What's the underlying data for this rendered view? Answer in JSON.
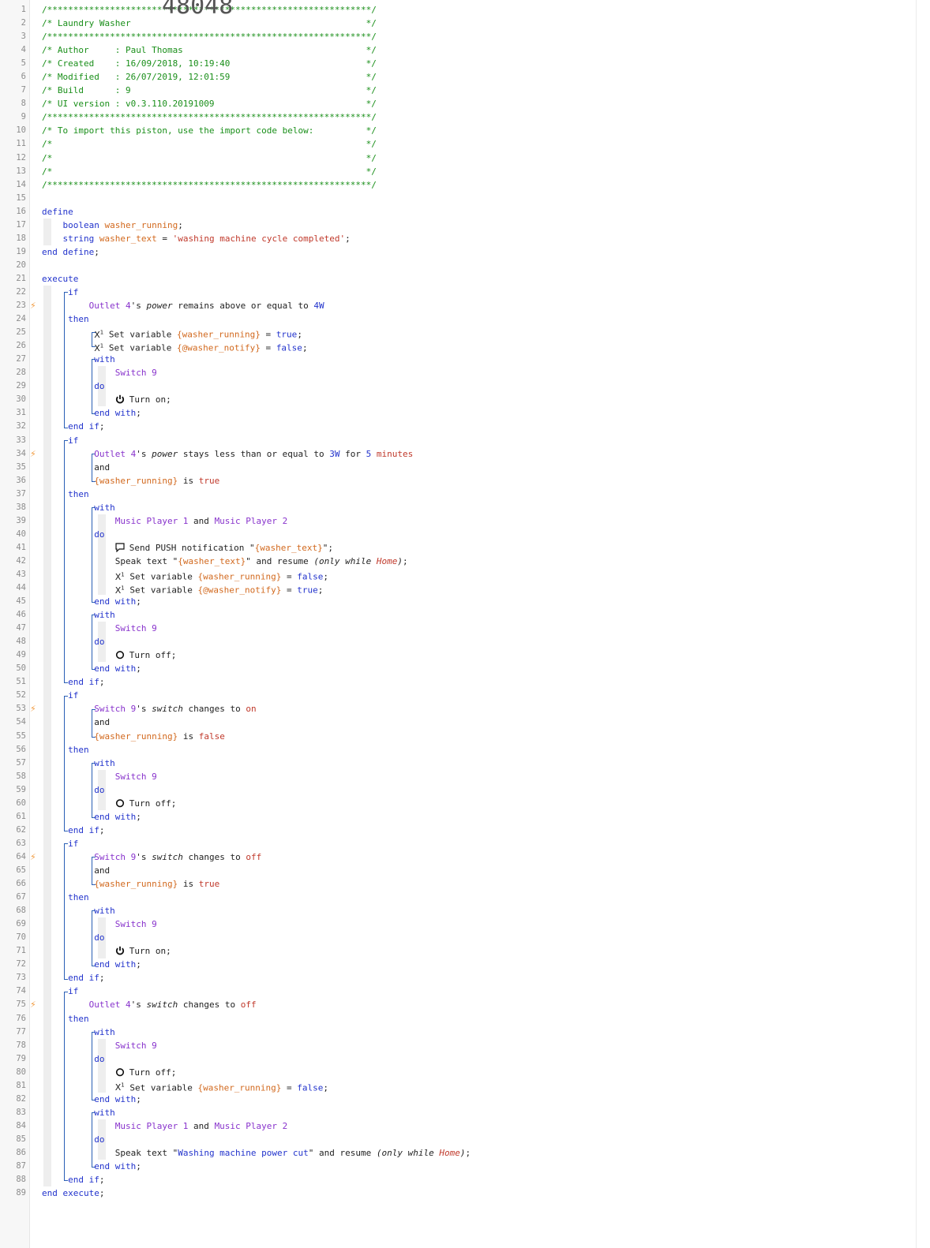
{
  "piston": {
    "name": "Laundry Washer",
    "author": "Paul Thomas",
    "created": "16/09/2018, 10:19:40",
    "modified": "26/07/2019, 12:01:59",
    "build": "9",
    "ui_version": "v0.3.110.20191009",
    "import_code": "48048"
  },
  "lines": [
    [
      {
        "c": "cmt",
        "t": "/**************************************************************/"
      }
    ],
    [
      {
        "c": "cmt",
        "t": "/* Laundry Washer                                             */"
      }
    ],
    [
      {
        "c": "cmt",
        "t": "/**************************************************************/"
      }
    ],
    [
      {
        "c": "cmt",
        "t": "/* Author     : Paul Thomas                                   */"
      }
    ],
    [
      {
        "c": "cmt",
        "t": "/* Created    : 16/09/2018, 10:19:40                          */"
      }
    ],
    [
      {
        "c": "cmt",
        "t": "/* Modified   : 26/07/2019, 12:01:59                          */"
      }
    ],
    [
      {
        "c": "cmt",
        "t": "/* Build      : 9                                             */"
      }
    ],
    [
      {
        "c": "cmt",
        "t": "/* UI version : v0.3.110.20191009                             */"
      }
    ],
    [
      {
        "c": "cmt",
        "t": "/**************************************************************/"
      }
    ],
    [
      {
        "c": "cmt",
        "t": "/* To import this piston, use the import code below:          */"
      }
    ],
    [
      {
        "c": "cmt",
        "t": "/*                                                            */"
      }
    ],
    [
      {
        "c": "cmt",
        "t": "/*                                                            */"
      }
    ],
    [
      {
        "c": "cmt",
        "t": "/*                                                            */"
      }
    ],
    [
      {
        "c": "cmt",
        "t": "/**************************************************************/"
      }
    ],
    [],
    [
      {
        "c": "kw",
        "t": "define"
      }
    ],
    [
      {
        "c": "sp",
        "t": "    "
      },
      {
        "c": "kw",
        "t": "boolean"
      },
      {
        "c": "plain",
        "t": " "
      },
      {
        "c": "var",
        "t": "washer_running"
      },
      {
        "c": "plain",
        "t": ";"
      }
    ],
    [
      {
        "c": "sp",
        "t": "    "
      },
      {
        "c": "kw",
        "t": "string"
      },
      {
        "c": "plain",
        "t": " "
      },
      {
        "c": "var",
        "t": "washer_text"
      },
      {
        "c": "plain",
        "t": " = "
      },
      {
        "c": "str",
        "t": "'washing machine cycle completed'"
      },
      {
        "c": "plain",
        "t": ";"
      }
    ],
    [
      {
        "c": "kw",
        "t": "end define"
      },
      {
        "c": "plain",
        "t": ";"
      }
    ],
    [],
    [
      {
        "c": "kw",
        "t": "execute"
      }
    ],
    [
      {
        "c": "sp",
        "t": "     "
      },
      {
        "c": "kw",
        "t": "if"
      }
    ],
    [
      {
        "c": "sp",
        "t": "         "
      },
      {
        "c": "dev",
        "t": "Outlet 4"
      },
      {
        "c": "plain",
        "t": "'s "
      },
      {
        "c": "em",
        "t": "power"
      },
      {
        "c": "plain",
        "t": " remains above or equal to "
      },
      {
        "c": "num",
        "t": "4W"
      }
    ],
    [
      {
        "c": "sp",
        "t": "     "
      },
      {
        "c": "kw",
        "t": "then"
      }
    ],
    [
      {
        "c": "sp",
        "t": "          "
      },
      {
        "c": "x",
        "t": "X"
      },
      {
        "c": "plain",
        "t": " Set variable "
      },
      {
        "c": "var",
        "t": "{washer_running}"
      },
      {
        "c": "plain",
        "t": " = "
      },
      {
        "c": "kw",
        "t": "true"
      },
      {
        "c": "plain",
        "t": ";"
      }
    ],
    [
      {
        "c": "sp",
        "t": "          "
      },
      {
        "c": "x",
        "t": "X"
      },
      {
        "c": "plain",
        "t": " Set variable "
      },
      {
        "c": "var",
        "t": "{@washer_notify}"
      },
      {
        "c": "plain",
        "t": " = "
      },
      {
        "c": "kw",
        "t": "false"
      },
      {
        "c": "plain",
        "t": ";"
      }
    ],
    [
      {
        "c": "sp",
        "t": "          "
      },
      {
        "c": "kw",
        "t": "with"
      }
    ],
    [
      {
        "c": "sp",
        "t": "              "
      },
      {
        "c": "dev",
        "t": "Switch 9"
      }
    ],
    [
      {
        "c": "sp",
        "t": "          "
      },
      {
        "c": "kw",
        "t": "do"
      }
    ],
    [
      {
        "c": "sp",
        "t": "              "
      },
      {
        "c": "pwr",
        "t": "on"
      },
      {
        "c": "plain",
        "t": "Turn on;"
      }
    ],
    [
      {
        "c": "sp",
        "t": "          "
      },
      {
        "c": "kw",
        "t": "end with"
      },
      {
        "c": "plain",
        "t": ";"
      }
    ],
    [
      {
        "c": "sp",
        "t": "     "
      },
      {
        "c": "kw",
        "t": "end if"
      },
      {
        "c": "plain",
        "t": ";"
      }
    ],
    [
      {
        "c": "sp",
        "t": "     "
      },
      {
        "c": "kw",
        "t": "if"
      }
    ],
    [
      {
        "c": "sp",
        "t": "          "
      },
      {
        "c": "dev",
        "t": "Outlet 4"
      },
      {
        "c": "plain",
        "t": "'s "
      },
      {
        "c": "em",
        "t": "power"
      },
      {
        "c": "plain",
        "t": " stays less than or equal to "
      },
      {
        "c": "num",
        "t": "3W"
      },
      {
        "c": "plain",
        "t": " for "
      },
      {
        "c": "num",
        "t": "5 "
      },
      {
        "c": "str",
        "t": "minutes"
      }
    ],
    [
      {
        "c": "sp",
        "t": "          "
      },
      {
        "c": "plain",
        "t": "and"
      }
    ],
    [
      {
        "c": "sp",
        "t": "          "
      },
      {
        "c": "var",
        "t": "{washer_running}"
      },
      {
        "c": "plain",
        "t": " is "
      },
      {
        "c": "str",
        "t": "true"
      }
    ],
    [
      {
        "c": "sp",
        "t": "     "
      },
      {
        "c": "kw",
        "t": "then"
      }
    ],
    [
      {
        "c": "sp",
        "t": "          "
      },
      {
        "c": "kw",
        "t": "with"
      }
    ],
    [
      {
        "c": "sp",
        "t": "              "
      },
      {
        "c": "dev",
        "t": "Music Player 1"
      },
      {
        "c": "plain",
        "t": " and "
      },
      {
        "c": "dev",
        "t": "Music Player 2"
      }
    ],
    [
      {
        "c": "sp",
        "t": "          "
      },
      {
        "c": "kw",
        "t": "do"
      }
    ],
    [
      {
        "c": "sp",
        "t": "              "
      },
      {
        "c": "chat",
        "t": "push"
      },
      {
        "c": "plain",
        "t": "Send PUSH notification \""
      },
      {
        "c": "var",
        "t": "{washer_text}"
      },
      {
        "c": "plain",
        "t": "\";"
      }
    ],
    [
      {
        "c": "sp",
        "t": "              "
      },
      {
        "c": "plain",
        "t": "Speak text \""
      },
      {
        "c": "var",
        "t": "{washer_text}"
      },
      {
        "c": "plain",
        "t": "\" and resume "
      },
      {
        "c": "em",
        "t": "(only while "
      },
      {
        "c": "emstr",
        "t": "Home"
      },
      {
        "c": "em",
        "t": ")"
      },
      {
        "c": "plain",
        "t": ";"
      }
    ],
    [
      {
        "c": "sp",
        "t": "              "
      },
      {
        "c": "x",
        "t": "X"
      },
      {
        "c": "plain",
        "t": " Set variable "
      },
      {
        "c": "var",
        "t": "{washer_running}"
      },
      {
        "c": "plain",
        "t": " = "
      },
      {
        "c": "kw",
        "t": "false"
      },
      {
        "c": "plain",
        "t": ";"
      }
    ],
    [
      {
        "c": "sp",
        "t": "              "
      },
      {
        "c": "x",
        "t": "X"
      },
      {
        "c": "plain",
        "t": " Set variable "
      },
      {
        "c": "var",
        "t": "{@washer_notify}"
      },
      {
        "c": "plain",
        "t": " = "
      },
      {
        "c": "kw",
        "t": "true"
      },
      {
        "c": "plain",
        "t": ";"
      }
    ],
    [
      {
        "c": "sp",
        "t": "          "
      },
      {
        "c": "kw",
        "t": "end with"
      },
      {
        "c": "plain",
        "t": ";"
      }
    ],
    [
      {
        "c": "sp",
        "t": "          "
      },
      {
        "c": "kw",
        "t": "with"
      }
    ],
    [
      {
        "c": "sp",
        "t": "              "
      },
      {
        "c": "dev",
        "t": "Switch 9"
      }
    ],
    [
      {
        "c": "sp",
        "t": "          "
      },
      {
        "c": "kw",
        "t": "do"
      }
    ],
    [
      {
        "c": "sp",
        "t": "              "
      },
      {
        "c": "pwr",
        "t": "off"
      },
      {
        "c": "plain",
        "t": "Turn off;"
      }
    ],
    [
      {
        "c": "sp",
        "t": "          "
      },
      {
        "c": "kw",
        "t": "end with"
      },
      {
        "c": "plain",
        "t": ";"
      }
    ],
    [
      {
        "c": "sp",
        "t": "     "
      },
      {
        "c": "kw",
        "t": "end if"
      },
      {
        "c": "plain",
        "t": ";"
      }
    ],
    [
      {
        "c": "sp",
        "t": "     "
      },
      {
        "c": "kw",
        "t": "if"
      }
    ],
    [
      {
        "c": "sp",
        "t": "          "
      },
      {
        "c": "dev",
        "t": "Switch 9"
      },
      {
        "c": "plain",
        "t": "'s "
      },
      {
        "c": "em",
        "t": "switch"
      },
      {
        "c": "plain",
        "t": " changes to "
      },
      {
        "c": "str",
        "t": "on"
      }
    ],
    [
      {
        "c": "sp",
        "t": "          "
      },
      {
        "c": "plain",
        "t": "and"
      }
    ],
    [
      {
        "c": "sp",
        "t": "          "
      },
      {
        "c": "var",
        "t": "{washer_running}"
      },
      {
        "c": "plain",
        "t": " is "
      },
      {
        "c": "str",
        "t": "false"
      }
    ],
    [
      {
        "c": "sp",
        "t": "     "
      },
      {
        "c": "kw",
        "t": "then"
      }
    ],
    [
      {
        "c": "sp",
        "t": "          "
      },
      {
        "c": "kw",
        "t": "with"
      }
    ],
    [
      {
        "c": "sp",
        "t": "              "
      },
      {
        "c": "dev",
        "t": "Switch 9"
      }
    ],
    [
      {
        "c": "sp",
        "t": "          "
      },
      {
        "c": "kw",
        "t": "do"
      }
    ],
    [
      {
        "c": "sp",
        "t": "              "
      },
      {
        "c": "pwr",
        "t": "off"
      },
      {
        "c": "plain",
        "t": "Turn off;"
      }
    ],
    [
      {
        "c": "sp",
        "t": "          "
      },
      {
        "c": "kw",
        "t": "end with"
      },
      {
        "c": "plain",
        "t": ";"
      }
    ],
    [
      {
        "c": "sp",
        "t": "     "
      },
      {
        "c": "kw",
        "t": "end if"
      },
      {
        "c": "plain",
        "t": ";"
      }
    ],
    [
      {
        "c": "sp",
        "t": "     "
      },
      {
        "c": "kw",
        "t": "if"
      }
    ],
    [
      {
        "c": "sp",
        "t": "          "
      },
      {
        "c": "dev",
        "t": "Switch 9"
      },
      {
        "c": "plain",
        "t": "'s "
      },
      {
        "c": "em",
        "t": "switch"
      },
      {
        "c": "plain",
        "t": " changes to "
      },
      {
        "c": "str",
        "t": "off"
      }
    ],
    [
      {
        "c": "sp",
        "t": "          "
      },
      {
        "c": "plain",
        "t": "and"
      }
    ],
    [
      {
        "c": "sp",
        "t": "          "
      },
      {
        "c": "var",
        "t": "{washer_running}"
      },
      {
        "c": "plain",
        "t": " is "
      },
      {
        "c": "str",
        "t": "true"
      }
    ],
    [
      {
        "c": "sp",
        "t": "     "
      },
      {
        "c": "kw",
        "t": "then"
      }
    ],
    [
      {
        "c": "sp",
        "t": "          "
      },
      {
        "c": "kw",
        "t": "with"
      }
    ],
    [
      {
        "c": "sp",
        "t": "              "
      },
      {
        "c": "dev",
        "t": "Switch 9"
      }
    ],
    [
      {
        "c": "sp",
        "t": "          "
      },
      {
        "c": "kw",
        "t": "do"
      }
    ],
    [
      {
        "c": "sp",
        "t": "              "
      },
      {
        "c": "pwr",
        "t": "on"
      },
      {
        "c": "plain",
        "t": "Turn on;"
      }
    ],
    [
      {
        "c": "sp",
        "t": "          "
      },
      {
        "c": "kw",
        "t": "end with"
      },
      {
        "c": "plain",
        "t": ";"
      }
    ],
    [
      {
        "c": "sp",
        "t": "     "
      },
      {
        "c": "kw",
        "t": "end if"
      },
      {
        "c": "plain",
        "t": ";"
      }
    ],
    [
      {
        "c": "sp",
        "t": "     "
      },
      {
        "c": "kw",
        "t": "if"
      }
    ],
    [
      {
        "c": "sp",
        "t": "         "
      },
      {
        "c": "dev",
        "t": "Outlet 4"
      },
      {
        "c": "plain",
        "t": "'s "
      },
      {
        "c": "em",
        "t": "switch"
      },
      {
        "c": "plain",
        "t": " changes to "
      },
      {
        "c": "str",
        "t": "off"
      }
    ],
    [
      {
        "c": "sp",
        "t": "     "
      },
      {
        "c": "kw",
        "t": "then"
      }
    ],
    [
      {
        "c": "sp",
        "t": "          "
      },
      {
        "c": "kw",
        "t": "with"
      }
    ],
    [
      {
        "c": "sp",
        "t": "              "
      },
      {
        "c": "dev",
        "t": "Switch 9"
      }
    ],
    [
      {
        "c": "sp",
        "t": "          "
      },
      {
        "c": "kw",
        "t": "do"
      }
    ],
    [
      {
        "c": "sp",
        "t": "              "
      },
      {
        "c": "pwr",
        "t": "off"
      },
      {
        "c": "plain",
        "t": "Turn off;"
      }
    ],
    [
      {
        "c": "sp",
        "t": "              "
      },
      {
        "c": "x",
        "t": "X"
      },
      {
        "c": "plain",
        "t": " Set variable "
      },
      {
        "c": "var",
        "t": "{washer_running}"
      },
      {
        "c": "plain",
        "t": " = "
      },
      {
        "c": "kw",
        "t": "false"
      },
      {
        "c": "plain",
        "t": ";"
      }
    ],
    [
      {
        "c": "sp",
        "t": "          "
      },
      {
        "c": "kw",
        "t": "end with"
      },
      {
        "c": "plain",
        "t": ";"
      }
    ],
    [
      {
        "c": "sp",
        "t": "          "
      },
      {
        "c": "kw",
        "t": "with"
      }
    ],
    [
      {
        "c": "sp",
        "t": "              "
      },
      {
        "c": "dev",
        "t": "Music Player 1"
      },
      {
        "c": "plain",
        "t": " and "
      },
      {
        "c": "dev",
        "t": "Music Player 2"
      }
    ],
    [
      {
        "c": "sp",
        "t": "          "
      },
      {
        "c": "kw",
        "t": "do"
      }
    ],
    [
      {
        "c": "sp",
        "t": "              "
      },
      {
        "c": "plain",
        "t": "Speak text \""
      },
      {
        "c": "num",
        "t": "Washing machine power cut"
      },
      {
        "c": "plain",
        "t": "\" and resume "
      },
      {
        "c": "em",
        "t": "(only while "
      },
      {
        "c": "emstr",
        "t": "Home"
      },
      {
        "c": "em",
        "t": ")"
      },
      {
        "c": "plain",
        "t": ";"
      }
    ],
    [
      {
        "c": "sp",
        "t": "          "
      },
      {
        "c": "kw",
        "t": "end with"
      },
      {
        "c": "plain",
        "t": ";"
      }
    ],
    [
      {
        "c": "sp",
        "t": "     "
      },
      {
        "c": "kw",
        "t": "end if"
      },
      {
        "c": "plain",
        "t": ";"
      }
    ],
    [
      {
        "c": "kw",
        "t": "end execute"
      },
      {
        "c": "plain",
        "t": ";"
      }
    ]
  ],
  "trigger_lines": [
    23,
    34,
    53,
    64,
    75
  ],
  "trigger_icon": "lightning-bolt-icon",
  "colors": {
    "comment": "#1a8f1a",
    "keyword": "#2233cc",
    "string": "#c0392b",
    "device": "#8833cc",
    "variable": "#d2691e",
    "trigger": "#f09a3e"
  }
}
